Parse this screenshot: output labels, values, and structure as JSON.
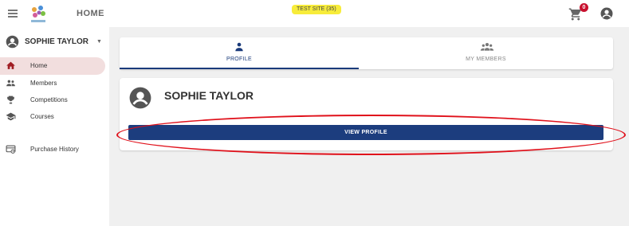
{
  "header": {
    "title": "HOME",
    "site_badge": "TEST SITE (35)",
    "cart_count": "0",
    "icons": {
      "menu": "hamburger-icon",
      "cart": "cart-icon",
      "account": "account-icon",
      "logo": "logo-image"
    }
  },
  "sidebar": {
    "user_name": "SOPHIE TAYLOR",
    "items": [
      {
        "label": "Home",
        "icon": "home-icon",
        "active": true
      },
      {
        "label": "Members",
        "icon": "members-icon",
        "active": false
      },
      {
        "label": "Competitions",
        "icon": "trophy-icon",
        "active": false
      },
      {
        "label": "Courses",
        "icon": "graduation-cap-icon",
        "active": false
      },
      {
        "label": "Purchase History",
        "icon": "receipt-icon",
        "active": false
      }
    ]
  },
  "main": {
    "tabs": [
      {
        "label": "PROFILE",
        "icon": "person-icon",
        "active": true
      },
      {
        "label": "MY MEMBERS",
        "icon": "group-icon",
        "active": false
      }
    ],
    "profile_card": {
      "name": "SOPHIE TAYLOR",
      "button_label": "VIEW PROFILE"
    }
  },
  "colors": {
    "primary": "#1c3d7e",
    "active_nav_bg": "#f2dede",
    "active_nav_icon": "#a01e24",
    "badge_yellow": "#f7ec3a",
    "cart_badge": "#c8102e",
    "highlight_red": "#e0111b"
  }
}
